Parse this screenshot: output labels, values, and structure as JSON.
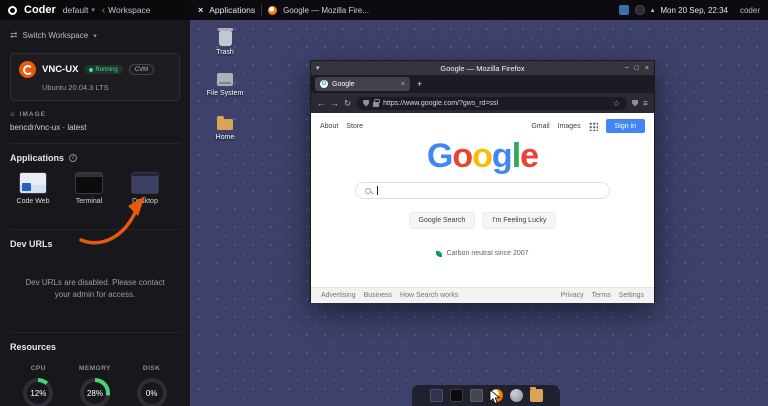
{
  "coder_nav": {
    "brand": "Coder",
    "org": "default",
    "breadcrumb": "Workspace"
  },
  "icons": {
    "chevron_down": "▾",
    "chevron_left": "‹",
    "caret_up": "▴",
    "x_logo": "×",
    "switch": "⇄",
    "info": "i",
    "minimize": "−",
    "maximize": "□",
    "close": "×",
    "plus": "+",
    "back": "←",
    "forward": "→",
    "reload": "↻",
    "star": "☆",
    "menu": "≡",
    "favicon_g": "G",
    "window_menu": "▾",
    "layers": "≡"
  },
  "colors": {
    "accent_orange": "#e8590c",
    "running_green": "#4ade80",
    "signin_blue": "#4285f4"
  },
  "panel": {
    "menu": "Applications",
    "window_button": "Google — Mozilla Fire...",
    "clock": "Mon 20 Sep, 22:34",
    "user": "coder"
  },
  "sidebar": {
    "switch_workspace": "Switch Workspace",
    "workspace": {
      "name": "VNC-UX",
      "status": "Running",
      "cvm": "CVM",
      "os": "Ubuntu 20.04.3 LTS"
    },
    "image": {
      "label": "IMAGE",
      "value": "bencdr/vnc-ux · latest"
    },
    "applications": {
      "title": "Applications",
      "tiles": [
        {
          "label": "Code Web"
        },
        {
          "label": "Terminal"
        },
        {
          "label": "Desktop"
        }
      ]
    },
    "dev_urls": {
      "title": "Dev URLs",
      "message": "Dev URLs are disabled. Please contact your admin for access."
    },
    "resources": {
      "title": "Resources",
      "items": [
        {
          "label": "CPU",
          "value": "12%",
          "percent": 12
        },
        {
          "label": "MEMORY",
          "value": "28%",
          "percent": 28
        },
        {
          "label": "DISK",
          "value": "0%",
          "percent": 0
        }
      ]
    }
  },
  "desktop": {
    "icons": [
      {
        "label": "Trash"
      },
      {
        "label": "File System"
      },
      {
        "label": "Home"
      }
    ]
  },
  "firefox": {
    "title": "Google — Mozilla Firefox",
    "tab": "Google",
    "url": "https://www.google.com/?gws_rd=ssl",
    "page": {
      "about": "About",
      "store": "Store",
      "gmail": "Gmail",
      "images": "Images",
      "sign_in": "Sign in",
      "logo": [
        {
          "ch": "G",
          "color": "#4285F4"
        },
        {
          "ch": "o",
          "color": "#EA4335"
        },
        {
          "ch": "o",
          "color": "#FBBC05"
        },
        {
          "ch": "g",
          "color": "#4285F4"
        },
        {
          "ch": "l",
          "color": "#34A853"
        },
        {
          "ch": "e",
          "color": "#EA4335"
        }
      ],
      "search_button": "Google Search",
      "lucky_button": "I'm Feeling Lucky",
      "carbon": "Carbon neutral since 2007",
      "footer_left": [
        "Advertising",
        "Business",
        "How Search works"
      ],
      "footer_right": [
        "Privacy",
        "Terms",
        "Settings"
      ]
    }
  }
}
